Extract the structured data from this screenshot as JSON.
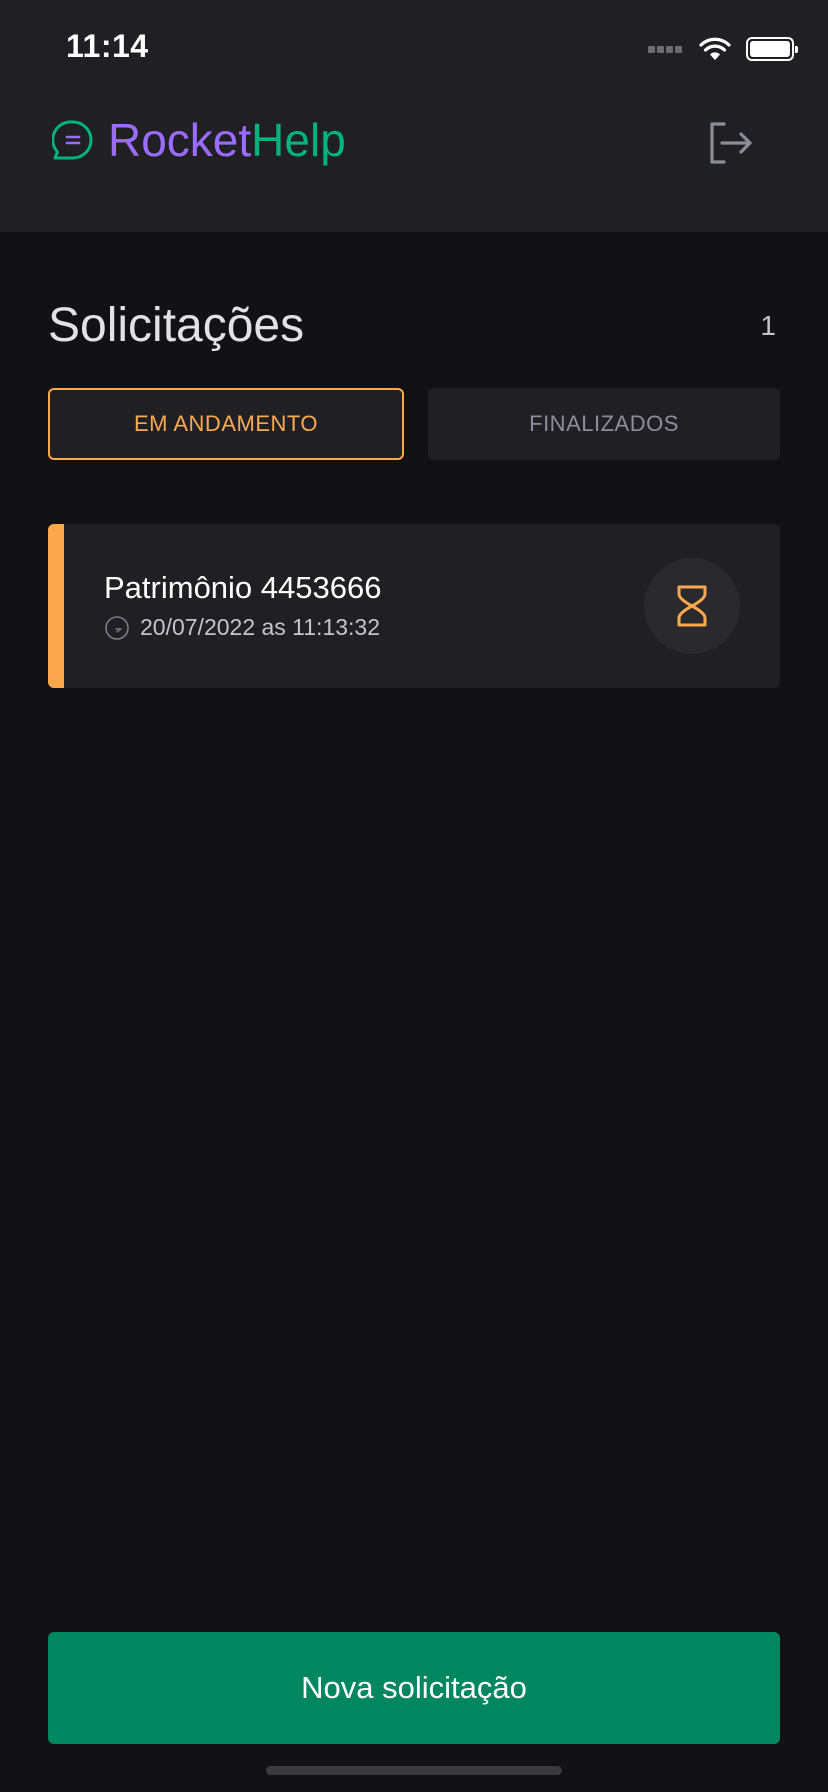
{
  "status_bar": {
    "time": "11:14"
  },
  "header": {
    "logo_part1": "Rocket",
    "logo_part2": "Help",
    "logo_colors": {
      "rocket": "#996DFF",
      "help": "#00B37E"
    },
    "logout_icon": "sign-out-icon"
  },
  "main": {
    "title": "Solicitações",
    "count": "1",
    "filters": [
      {
        "label": "EM ANDAMENTO",
        "active": true,
        "color": "#FBA94C"
      },
      {
        "label": "FINALIZADOS",
        "active": false
      }
    ],
    "orders": [
      {
        "title": "Patrimônio 4453666",
        "date": "20/07/2022 as 11:13:32",
        "status": "open",
        "status_icon": "hourglass-icon",
        "status_color": "#FBA94C"
      }
    ]
  },
  "footer": {
    "new_button_label": "Nova solicitação",
    "button_color": "#00875F"
  }
}
